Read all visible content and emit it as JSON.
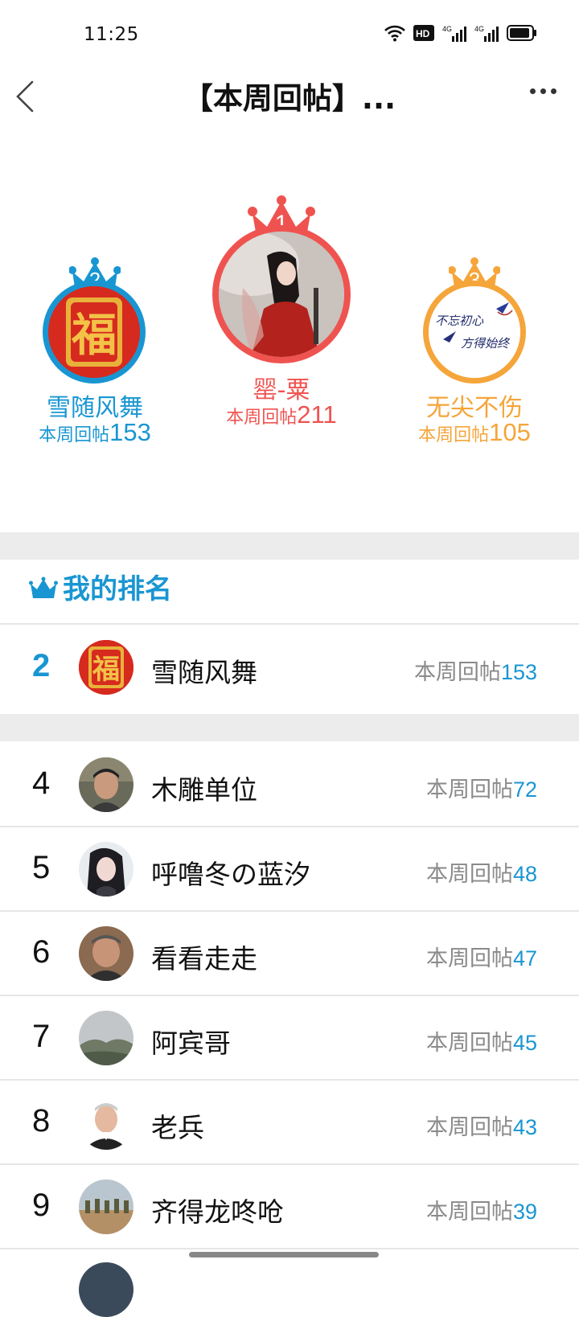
{
  "status_bar": {
    "time": "11:25",
    "hd": "HD",
    "net1": "4G",
    "net2": "4G"
  },
  "header": {
    "title": "【本周回帖】..."
  },
  "podium": {
    "first": {
      "rank": "1",
      "name": "罂-粟",
      "stat_label": "本周回帖",
      "stat_value": "211",
      "color": "#ef5350"
    },
    "second": {
      "rank": "2",
      "name": "雪随风舞",
      "stat_label": "本周回帖",
      "stat_value": "153",
      "color": "#1996d2"
    },
    "third": {
      "rank": "3",
      "name": "无尖不伤",
      "stat_label": "本周回帖",
      "stat_value": "105",
      "color": "#f5a53a"
    },
    "third_avatar_text_1": "不忘初心",
    "third_avatar_text_2": "方得始终",
    "second_avatar_text": "福"
  },
  "my_rank": {
    "title": "我的排名",
    "rank": "2",
    "name": "雪随风舞",
    "stat_label": "本周回帖",
    "stat_value": "153"
  },
  "list": [
    {
      "rank": "4",
      "name": "木雕单位",
      "stat_label": "本周回帖",
      "stat_value": "72"
    },
    {
      "rank": "5",
      "name": "呼噜冬の蓝汐",
      "stat_label": "本周回帖",
      "stat_value": "48"
    },
    {
      "rank": "6",
      "name": "看看走走",
      "stat_label": "本周回帖",
      "stat_value": "47"
    },
    {
      "rank": "7",
      "name": "阿宾哥",
      "stat_label": "本周回帖",
      "stat_value": "45"
    },
    {
      "rank": "8",
      "name": "老兵",
      "stat_label": "本周回帖",
      "stat_value": "43"
    },
    {
      "rank": "9",
      "name": "齐得龙咚呛",
      "stat_label": "本周回帖",
      "stat_value": "39"
    }
  ]
}
